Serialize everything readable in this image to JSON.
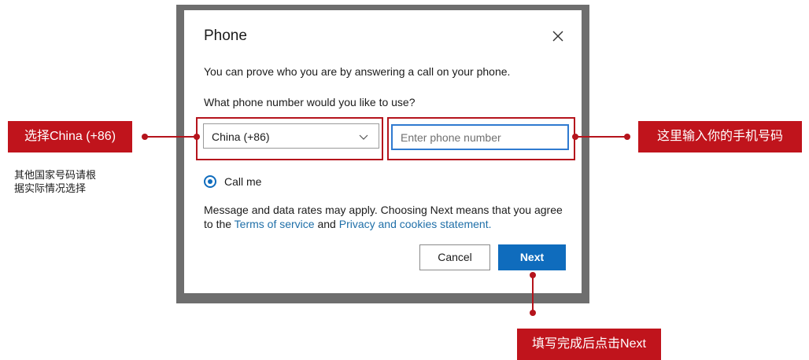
{
  "dialog": {
    "title": "Phone",
    "description": "You can prove who you are by answering a call on your phone.",
    "question": "What phone number would you like to use?",
    "country_select": {
      "value": "China (+86)"
    },
    "phone_input": {
      "placeholder": "Enter phone number",
      "value": ""
    },
    "method": {
      "label": "Call me",
      "selected": true
    },
    "legal": {
      "text_before": "Message and data rates may apply. Choosing Next means that you agree to the ",
      "terms_link": "Terms of service",
      "text_middle": " and ",
      "privacy_link": "Privacy and cookies statement.",
      "text_after": ""
    },
    "buttons": {
      "cancel": "Cancel",
      "next": "Next"
    }
  },
  "annotations": {
    "left_callout": "选择China (+86)",
    "left_note_line1": "其他国家号码请根",
    "left_note_line2": "据实际情况选择",
    "right_callout": "这里输入你的手机号码",
    "bottom_callout": "填写完成后点击Next"
  },
  "colors": {
    "accent": "#0f6cbd",
    "annotation_red": "#c0141c",
    "link": "#1f6fa8"
  },
  "icons": [
    "close-icon",
    "chevron-down-icon",
    "radio-selected-icon"
  ]
}
